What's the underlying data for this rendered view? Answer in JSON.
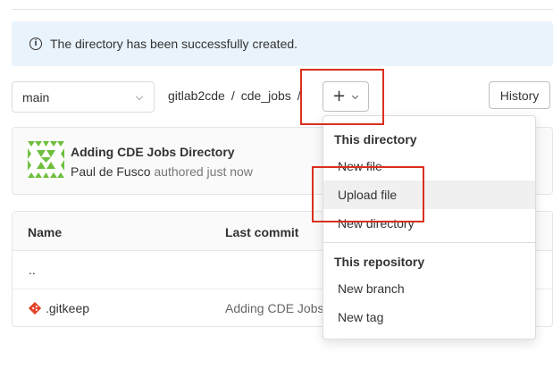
{
  "alert": {
    "message": "The directory has been successfully created.",
    "icon": "info-icon"
  },
  "branch": {
    "selected": "main"
  },
  "breadcrumb": {
    "project": "gitlab2cde",
    "separator": "/",
    "folder": "cde_jobs"
  },
  "add_button": {
    "label": "+"
  },
  "history_button": {
    "label": "History"
  },
  "commit": {
    "title": "Adding CDE Jobs Directory",
    "author": "Paul de Fusco",
    "authored": "authored just now"
  },
  "table": {
    "headers": {
      "name": "Name",
      "last_commit": "Last commit"
    },
    "rows": [
      {
        "name": "..",
        "last_commit": ""
      },
      {
        "name": ".gitkeep",
        "last_commit": "Adding CDE Jobs"
      }
    ]
  },
  "dropdown": {
    "sections": [
      {
        "header": "This directory",
        "items": [
          "New file",
          "Upload file",
          "New directory"
        ]
      },
      {
        "header": "This repository",
        "items": [
          "New branch",
          "New tag"
        ]
      }
    ]
  },
  "colors": {
    "alert_bg": "#e9f3fc",
    "highlight": "#d9301e",
    "file_icon": "#e24329",
    "avatar_green": "#6fbf3f"
  }
}
